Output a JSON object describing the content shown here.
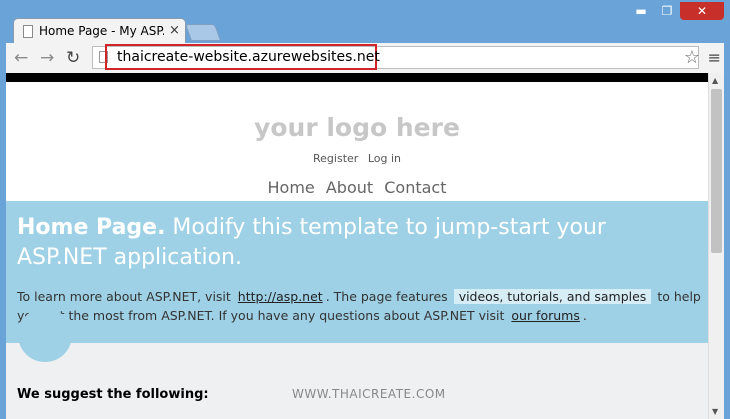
{
  "browser": {
    "tab_title": "Home Page - My ASP.NET",
    "tab_close": "×",
    "window_buttons": {
      "minimize": "▬",
      "maximize": "❐",
      "close": "✕"
    },
    "nav": {
      "back": "←",
      "forward": "→",
      "reload": "↻"
    },
    "url": "thaicreate-website.azurewebsites.net",
    "star": "☆",
    "menu": "≡",
    "scroll_up": "▲",
    "scroll_down": "▼"
  },
  "page": {
    "logo": "your logo here",
    "login_links": [
      "Register",
      "Log in"
    ],
    "nav_links": [
      "Home",
      "About",
      "Contact"
    ],
    "featured": {
      "title_bold": "Home Page.",
      "title_rest": " Modify this template to jump-start your ASP.NET application.",
      "body_1": "To learn more about ASP.NET, visit",
      "link_1": "http://asp.net",
      "body_2": ". The page features",
      "highlight": "videos, tutorials, and samples",
      "body_3": "to help you get the most from ASP.NET. If you have any questions about ASP.NET visit",
      "link_2": "our forums",
      "body_4": "."
    },
    "suggest_heading": "We suggest the following:"
  },
  "watermark": "WWW.THAICREATE.COM",
  "colors": {
    "accent": "#9fd1e6",
    "highlight_border": "#d0242a",
    "frame": "#6aa3d8"
  }
}
